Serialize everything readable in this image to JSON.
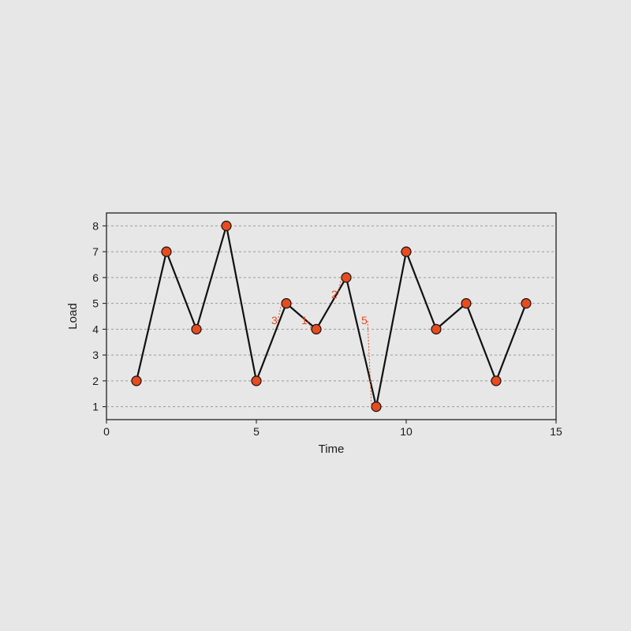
{
  "chart_data": {
    "type": "line",
    "xlabel": "Time",
    "ylabel": "Load",
    "xlim": [
      0,
      15
    ],
    "ylim": [
      0.5,
      8.5
    ],
    "x_ticks": [
      0,
      5,
      10,
      15
    ],
    "y_ticks": [
      1,
      2,
      3,
      4,
      5,
      6,
      7,
      8
    ],
    "grid": {
      "y": true,
      "x": false
    },
    "x": [
      1,
      2,
      3,
      4,
      5,
      6,
      7,
      8,
      9,
      10,
      11,
      12,
      13,
      14
    ],
    "values": [
      2,
      7,
      4,
      8,
      2,
      5,
      4,
      6,
      1,
      7,
      4,
      5,
      2,
      5
    ],
    "annotations": [
      {
        "at_x": 6,
        "at_y": 5,
        "tx": 5.5,
        "ty": 4.2,
        "text": "3"
      },
      {
        "at_x": 7,
        "at_y": 4,
        "tx": 6.5,
        "ty": 4.2,
        "text": "1"
      },
      {
        "at_x": 8,
        "at_y": 6,
        "tx": 7.5,
        "ty": 5.2,
        "text": "2"
      },
      {
        "at_x": 9,
        "at_y": 1,
        "tx": 8.5,
        "ty": 4.2,
        "text": "5"
      }
    ]
  }
}
